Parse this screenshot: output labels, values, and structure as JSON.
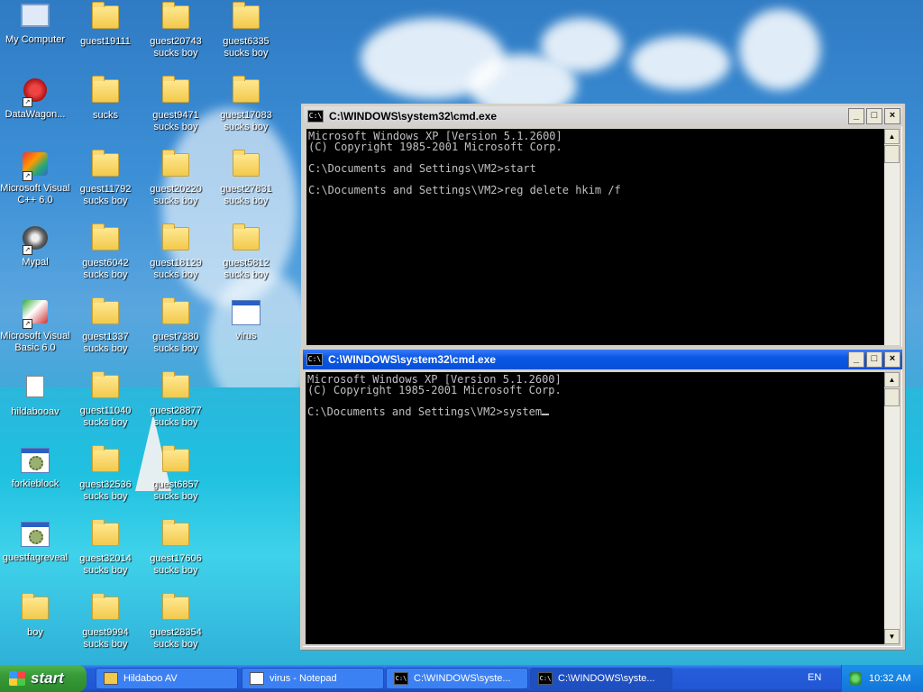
{
  "desktop": {
    "icons": [
      {
        "name": "my-computer-icon",
        "label": "My Computer",
        "line2": ""
      },
      {
        "name": "datawagon-icon",
        "label": "DataWagon...",
        "line2": ""
      },
      {
        "name": "visual-cpp-icon",
        "label": "Microsoft Visual",
        "line2": "C++ 6.0"
      },
      {
        "name": "mypal-icon",
        "label": "Mypal",
        "line2": ""
      },
      {
        "name": "visual-basic-icon",
        "label": "Microsoft Visual",
        "line2": "Basic 6.0"
      },
      {
        "name": "hildabooav-icon",
        "label": "hildabooav",
        "line2": ""
      },
      {
        "name": "forkieblock-icon",
        "label": "forkieblock",
        "line2": ""
      },
      {
        "name": "guestfagreveal-icon",
        "label": "guestfagreveal",
        "line2": ""
      },
      {
        "name": "folder-icon",
        "label": "boy",
        "line2": ""
      },
      {
        "name": "folder-icon",
        "label": "guest19111",
        "line2": ""
      },
      {
        "name": "folder-icon",
        "label": "sucks",
        "line2": ""
      },
      {
        "name": "folder-icon",
        "label": "guest11792",
        "line2": "sucks boy"
      },
      {
        "name": "folder-icon",
        "label": "guest6042",
        "line2": "sucks boy"
      },
      {
        "name": "folder-icon",
        "label": "guest1337",
        "line2": "sucks boy"
      },
      {
        "name": "folder-icon",
        "label": "guest11040",
        "line2": "sucks boy"
      },
      {
        "name": "folder-icon",
        "label": "guest32536",
        "line2": "sucks boy"
      },
      {
        "name": "folder-icon",
        "label": "guest32014",
        "line2": "sucks boy"
      },
      {
        "name": "folder-icon",
        "label": "guest9994",
        "line2": "sucks boy"
      },
      {
        "name": "folder-icon",
        "label": "guest20743",
        "line2": "sucks boy"
      },
      {
        "name": "folder-icon",
        "label": "guest9471",
        "line2": "sucks boy"
      },
      {
        "name": "folder-icon",
        "label": "guest20220",
        "line2": "sucks boy"
      },
      {
        "name": "folder-icon",
        "label": "guest18129",
        "line2": "sucks boy"
      },
      {
        "name": "folder-icon",
        "label": "guest7380",
        "line2": "sucks boy"
      },
      {
        "name": "folder-icon",
        "label": "guest28877",
        "line2": "sucks boy"
      },
      {
        "name": "folder-icon",
        "label": "guest6857",
        "line2": "sucks boy"
      },
      {
        "name": "folder-icon",
        "label": "guest17606",
        "line2": "sucks boy"
      },
      {
        "name": "folder-icon",
        "label": "guest28354",
        "line2": "sucks boy"
      },
      {
        "name": "folder-icon",
        "label": "guest6335",
        "line2": "sucks boy"
      },
      {
        "name": "folder-icon",
        "label": "guest17083",
        "line2": "sucks boy"
      },
      {
        "name": "folder-icon",
        "label": "guest27831",
        "line2": "sucks boy"
      },
      {
        "name": "folder-icon",
        "label": "guest5812",
        "line2": "sucks boy"
      },
      {
        "name": "window-icon",
        "label": "virus",
        "line2": ""
      }
    ]
  },
  "cmd_back": {
    "title": "C:\\WINDOWS\\system32\\cmd.exe",
    "icon_text": "C:\\",
    "lines": [
      "Microsoft Windows XP [Version 5.1.2600]",
      "(C) Copyright 1985-2001 Microsoft Corp.",
      "",
      "C:\\Documents and Settings\\VM2>start",
      "",
      "C:\\Documents and Settings\\VM2>reg delete hkim /f"
    ]
  },
  "cmd_front": {
    "title": "C:\\WINDOWS\\system32\\cmd.exe",
    "icon_text": "C:\\",
    "lines": [
      "Microsoft Windows XP [Version 5.1.2600]",
      "(C) Copyright 1985-2001 Microsoft Corp.",
      "",
      "C:\\Documents and Settings\\VM2>system"
    ]
  },
  "window_buttons": {
    "minimize": "_",
    "maximize": "□",
    "close": "×"
  },
  "taskbar": {
    "start_label": "start",
    "tasks": [
      {
        "label": "Hildaboo AV",
        "icon": "folder"
      },
      {
        "label": "virus - Notepad",
        "icon": "notepad"
      },
      {
        "label": "C:\\WINDOWS\\syste...",
        "icon": "cmd"
      },
      {
        "label": "C:\\WINDOWS\\syste...",
        "icon": "cmd"
      }
    ],
    "language": "EN",
    "clock": "10:32 AM"
  },
  "colors": {
    "taskbar": "#245edb",
    "start_green": "#379a37",
    "title_active": "#0a58e6"
  }
}
